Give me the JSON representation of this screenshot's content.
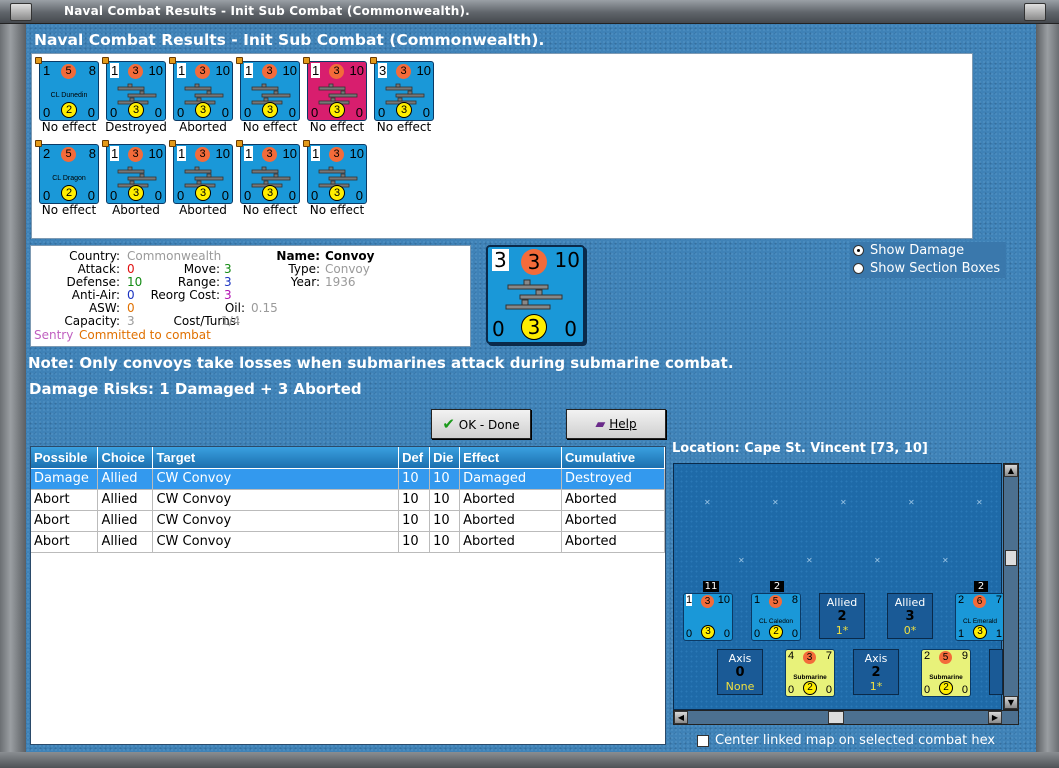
{
  "window": {
    "title": "Naval Combat Results - Init Sub Combat (Commonwealth)."
  },
  "header": "Naval Combat Results - Init Sub Combat (Commonwealth).",
  "units_row1": [
    {
      "tl": "1",
      "circle": "5",
      "tr": "8",
      "name": "CL Dunedin",
      "bl": "0",
      "bcircle": "2",
      "br": "0",
      "color": "#1a98d8",
      "result": "No effect"
    },
    {
      "tl": "1",
      "circle": "3",
      "tr": "10",
      "name": "",
      "bl": "0",
      "bcircle": "3",
      "br": "0",
      "color": "#1a98d8",
      "result": "Destroyed"
    },
    {
      "tl": "1",
      "circle": "3",
      "tr": "10",
      "name": "",
      "bl": "0",
      "bcircle": "3",
      "br": "0",
      "color": "#1a98d8",
      "result": "Aborted"
    },
    {
      "tl": "1",
      "circle": "3",
      "tr": "10",
      "name": "",
      "bl": "0",
      "bcircle": "3",
      "br": "0",
      "color": "#1a98d8",
      "result": "No effect"
    },
    {
      "tl": "1",
      "circle": "3",
      "tr": "10",
      "name": "",
      "bl": "0",
      "bcircle": "3",
      "br": "0",
      "color": "#d81e6e",
      "result": "No effect"
    },
    {
      "tl": "3",
      "circle": "3",
      "tr": "10",
      "name": "",
      "bl": "0",
      "bcircle": "3",
      "br": "0",
      "color": "#1a98d8",
      "result": "No effect"
    }
  ],
  "units_row2": [
    {
      "tl": "2",
      "circle": "5",
      "tr": "8",
      "name": "CL Dragon",
      "bl": "0",
      "bcircle": "2",
      "br": "0",
      "color": "#1a98d8",
      "result": "No effect"
    },
    {
      "tl": "1",
      "circle": "3",
      "tr": "10",
      "name": "",
      "bl": "0",
      "bcircle": "3",
      "br": "0",
      "color": "#1a98d8",
      "result": "Aborted"
    },
    {
      "tl": "1",
      "circle": "3",
      "tr": "10",
      "name": "",
      "bl": "0",
      "bcircle": "3",
      "br": "0",
      "color": "#1a98d8",
      "result": "Aborted"
    },
    {
      "tl": "1",
      "circle": "3",
      "tr": "10",
      "name": "",
      "bl": "0",
      "bcircle": "3",
      "br": "0",
      "color": "#1a98d8",
      "result": "No effect"
    },
    {
      "tl": "1",
      "circle": "3",
      "tr": "10",
      "name": "",
      "bl": "0",
      "bcircle": "3",
      "br": "0",
      "color": "#1a98d8",
      "result": "No effect"
    }
  ],
  "info": {
    "country_label": "Country:",
    "country": "Commonwealth",
    "attack_label": "Attack:",
    "attack": "0",
    "defense_label": "Defense:",
    "defense": "10",
    "antiair_label": "Anti-Air:",
    "antiair": "0",
    "asw_label": "ASW:",
    "asw": "0",
    "capacity_label": "Capacity:",
    "capacity": "3",
    "move_label": "Move:",
    "move": "3",
    "range_label": "Range:",
    "range": "3",
    "reorg_label": "Reorg Cost:",
    "reorg": "3",
    "oil_label": "Oil:",
    "oil": "0.15",
    "costturns_label": "Cost/Turns:",
    "costturns": "1/4",
    "name_label": "Name:",
    "name": "Convoy",
    "type_label": "Type:",
    "type": "Convoy",
    "year_label": "Year:",
    "year": "1936",
    "sentry": "Sentry",
    "committed": "Committed to combat"
  },
  "bigcard": {
    "tl": "3",
    "circle": "3",
    "tr": "10",
    "bl": "0",
    "bcircle": "3",
    "br": "0"
  },
  "radios": {
    "show_damage": "Show Damage",
    "show_sections": "Show Section Boxes",
    "selected": "show_damage"
  },
  "note": "Note: Only convoys take losses when submarines attack during submarine combat.",
  "risks": "Damage Risks:  1 Damaged + 3 Aborted",
  "buttons": {
    "ok": "OK - Done",
    "help": "Help"
  },
  "table": {
    "headers": [
      "Possible",
      "Choice",
      "Target",
      "Def",
      "Die",
      "Effect",
      "Cumulative"
    ],
    "rows": [
      [
        "Damage",
        "Allied",
        "CW Convoy",
        "10",
        "10",
        "Damaged",
        "Destroyed"
      ],
      [
        "Abort",
        "Allied",
        "CW Convoy",
        "10",
        "10",
        "Aborted",
        "Aborted"
      ],
      [
        "Abort",
        "Allied",
        "CW Convoy",
        "10",
        "10",
        "Aborted",
        "Aborted"
      ],
      [
        "Abort",
        "Allied",
        "CW Convoy",
        "10",
        "10",
        "Aborted",
        "Aborted"
      ]
    ],
    "selected_row": 0
  },
  "location": "Location:  Cape St. Vincent [73, 10]",
  "map": {
    "stack_counts": [
      "11",
      "2",
      "2"
    ],
    "card1": {
      "tl": "1",
      "circle": "3",
      "tr": "10",
      "bl": "0",
      "bcircle": "3",
      "br": "0",
      "name": ""
    },
    "card2": {
      "tl": "1",
      "circle": "5",
      "tr": "8",
      "bl": "0",
      "bcircle": "2",
      "br": "0",
      "name": "CL Caledon"
    },
    "card3": {
      "tl": "2",
      "circle": "6",
      "tr": "7",
      "bl": "1",
      "bcircle": "3",
      "br": "1",
      "name": "CL Emerald"
    },
    "sub1": {
      "tl": "4",
      "circle": "3",
      "tr": "7",
      "bl": "0",
      "bcircle": "2",
      "br": "0",
      "name": "Submarine"
    },
    "sub2": {
      "tl": "2",
      "circle": "5",
      "tr": "9",
      "bl": "0",
      "bcircle": "2",
      "br": "0",
      "name": "Submarine"
    },
    "allied_boxes": [
      {
        "label": "Allied",
        "num": "2",
        "sub": "1*"
      },
      {
        "label": "Allied",
        "num": "3",
        "sub": "0*"
      }
    ],
    "axis_boxes": [
      {
        "label": "Axis",
        "num": "0",
        "sub": "None"
      },
      {
        "label": "Axis",
        "num": "2",
        "sub": "1*"
      }
    ]
  },
  "center_linked": "Center linked map on selected combat hex"
}
